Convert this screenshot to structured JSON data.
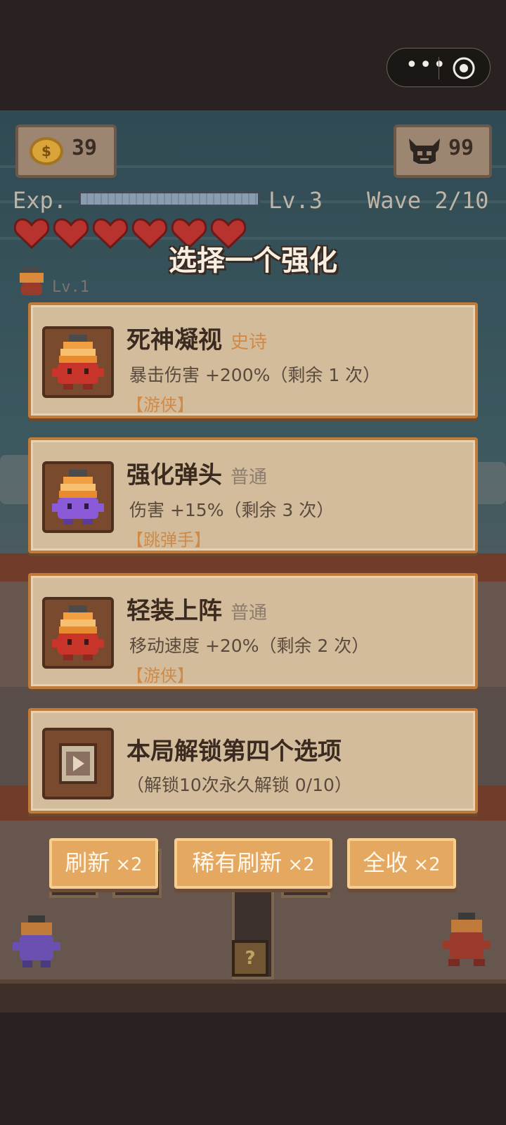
{
  "system": {
    "more_icon": "more-dots-icon",
    "target_icon": "record-target-icon"
  },
  "hud": {
    "coins": "39",
    "enemies": "99",
    "exp_label": "Exp.",
    "exp_progress": 1.0,
    "level": "Lv.3",
    "wave": "Wave 2/10",
    "hearts": 6,
    "ally_level": "Lv.1"
  },
  "title": "选择一个强化",
  "cards": [
    {
      "name": "死神凝视",
      "rarity": "史诗",
      "rarity_color": "#d08a48",
      "desc": "暴击伤害 +200%（剩余 1 次）",
      "tag": "【游侠】",
      "hero": "red-drill-hero"
    },
    {
      "name": "强化弹头",
      "rarity": "普通",
      "rarity_color": "#8c7c6e",
      "desc": "伤害 +15%（剩余 3 次）",
      "tag": "【跳弹手】",
      "hero": "purple-drill-hero"
    },
    {
      "name": "轻装上阵",
      "rarity": "普通",
      "rarity_color": "#8c7c6e",
      "desc": "移动速度 +20%（剩余 2 次）",
      "tag": "【游侠】",
      "hero": "red-drill-hero"
    },
    {
      "name": "本局解锁第四个选项",
      "desc": "（解锁10次永久解锁 0/10）",
      "icon": "video-ad-icon"
    }
  ],
  "buttons": [
    {
      "label": "刷新",
      "mult": "×2"
    },
    {
      "label": "稀有刷新",
      "mult": "×2"
    },
    {
      "label": "全收",
      "mult": "×2"
    }
  ],
  "colors": {
    "accent": "#e4a860",
    "card_bg": "#d3bc9b",
    "card_border": "#c07a3a",
    "heart": "#b8322e"
  }
}
